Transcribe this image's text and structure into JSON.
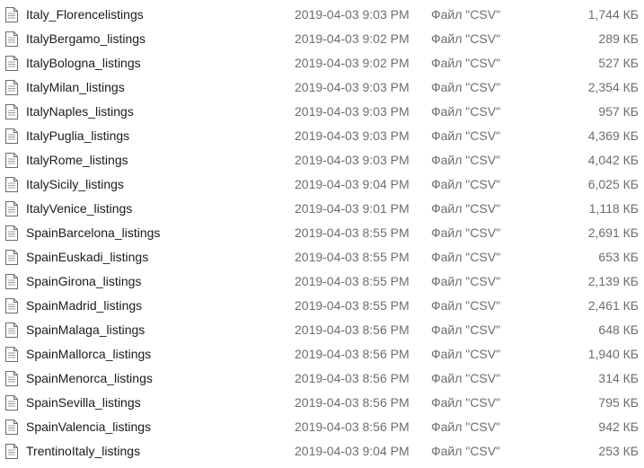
{
  "file_icon": "text-document-icon",
  "files": [
    {
      "name": "Italy_Florencelistings",
      "date": "2019-04-03 9:03 PM",
      "type": "Файл \"CSV\"",
      "size": "1,744 КБ"
    },
    {
      "name": "ItalyBergamo_listings",
      "date": "2019-04-03 9:02 PM",
      "type": "Файл \"CSV\"",
      "size": "289 КБ"
    },
    {
      "name": "ItalyBologna_listings",
      "date": "2019-04-03 9:02 PM",
      "type": "Файл \"CSV\"",
      "size": "527 КБ"
    },
    {
      "name": "ItalyMilan_listings",
      "date": "2019-04-03 9:03 PM",
      "type": "Файл \"CSV\"",
      "size": "2,354 КБ"
    },
    {
      "name": "ItalyNaples_listings",
      "date": "2019-04-03 9:03 PM",
      "type": "Файл \"CSV\"",
      "size": "957 КБ"
    },
    {
      "name": "ItalyPuglia_listings",
      "date": "2019-04-03 9:03 PM",
      "type": "Файл \"CSV\"",
      "size": "4,369 КБ"
    },
    {
      "name": "ItalyRome_listings",
      "date": "2019-04-03 9:03 PM",
      "type": "Файл \"CSV\"",
      "size": "4,042 КБ"
    },
    {
      "name": "ItalySicily_listings",
      "date": "2019-04-03 9:04 PM",
      "type": "Файл \"CSV\"",
      "size": "6,025 КБ"
    },
    {
      "name": "ItalyVenice_listings",
      "date": "2019-04-03 9:01 PM",
      "type": "Файл \"CSV\"",
      "size": "1,118 КБ"
    },
    {
      "name": "SpainBarcelona_listings",
      "date": "2019-04-03 8:55 PM",
      "type": "Файл \"CSV\"",
      "size": "2,691 КБ"
    },
    {
      "name": "SpainEuskadi_listings",
      "date": "2019-04-03 8:55 PM",
      "type": "Файл \"CSV\"",
      "size": "653 КБ"
    },
    {
      "name": "SpainGirona_listings",
      "date": "2019-04-03 8:55 PM",
      "type": "Файл \"CSV\"",
      "size": "2,139 КБ"
    },
    {
      "name": "SpainMadrid_listings",
      "date": "2019-04-03 8:55 PM",
      "type": "Файл \"CSV\"",
      "size": "2,461 КБ"
    },
    {
      "name": "SpainMalaga_listings",
      "date": "2019-04-03 8:56 PM",
      "type": "Файл \"CSV\"",
      "size": "648 КБ"
    },
    {
      "name": "SpainMallorca_listings",
      "date": "2019-04-03 8:56 PM",
      "type": "Файл \"CSV\"",
      "size": "1,940 КБ"
    },
    {
      "name": "SpainMenorca_listings",
      "date": "2019-04-03 8:56 PM",
      "type": "Файл \"CSV\"",
      "size": "314 КБ"
    },
    {
      "name": "SpainSevilla_listings",
      "date": "2019-04-03 8:56 PM",
      "type": "Файл \"CSV\"",
      "size": "795 КБ"
    },
    {
      "name": "SpainValencia_listings",
      "date": "2019-04-03 8:56 PM",
      "type": "Файл \"CSV\"",
      "size": "942 КБ"
    },
    {
      "name": "TrentinoItaly_listings",
      "date": "2019-04-03 9:04 PM",
      "type": "Файл \"CSV\"",
      "size": "253 КБ"
    }
  ]
}
